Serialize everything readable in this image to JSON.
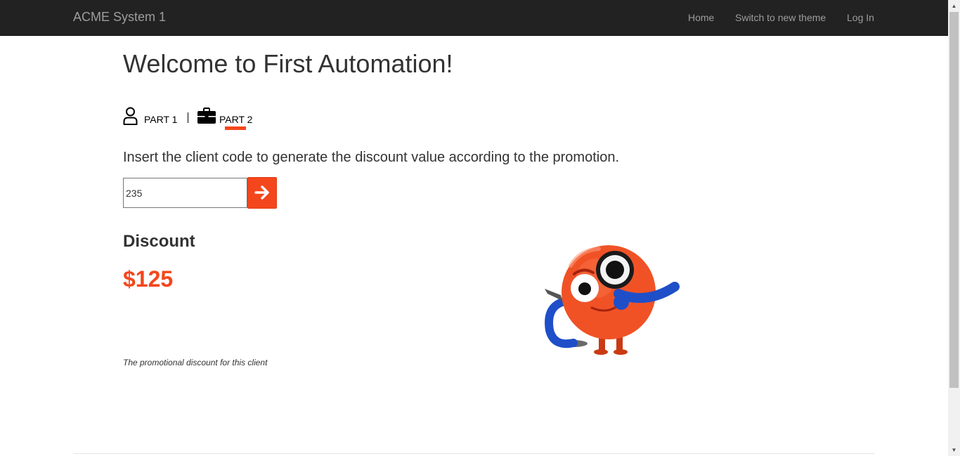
{
  "navbar": {
    "brand": "ACME System 1",
    "links": [
      "Home",
      "Switch to new theme",
      "Log In"
    ]
  },
  "page": {
    "title": "Welcome to First Automation!",
    "tabs": [
      {
        "label": "PART 1",
        "icon": "user-icon",
        "active": false
      },
      {
        "label": "PART 2",
        "icon": "briefcase-icon",
        "active": true
      }
    ],
    "instruction": "Insert the client code to generate the discount value according to the promotion.",
    "client_code": "235",
    "submit_icon": "arrow-right-icon",
    "discount_title": "Discount",
    "discount_value": "$125",
    "caption": "The promotional discount for this client"
  },
  "colors": {
    "accent": "#f4461c",
    "navbar_bg": "#222222",
    "navbar_text": "#9d9d9d"
  }
}
